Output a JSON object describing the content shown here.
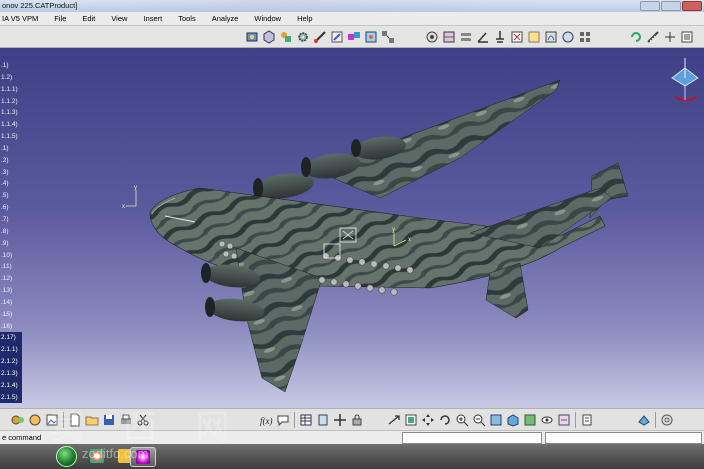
{
  "window": {
    "title": "onov 225.CATProduct]"
  },
  "menubar": {
    "app_label": "IA V5 VPM",
    "items": [
      {
        "label": "File"
      },
      {
        "label": "Edit"
      },
      {
        "label": "View"
      },
      {
        "label": "Insert"
      },
      {
        "label": "Tools"
      },
      {
        "label": "Analyze"
      },
      {
        "label": "Window"
      },
      {
        "label": "Help"
      }
    ]
  },
  "tree": {
    "items": [
      ".1)",
      "1.2)",
      "1.1.1)",
      "1.1.2)",
      "1.1.3)",
      "1.1.4)",
      "1.1.5)",
      ".1)",
      ".2)",
      ".3)",
      ".4)",
      ".5)",
      ".6)",
      ".7)",
      ".8)",
      ".9)",
      ".10)",
      ".11)",
      ".12)",
      ".13)",
      ".14)",
      ".15)",
      ".16)",
      "2.17)",
      "2.1.1)",
      "2.1.2)",
      "2.1.3)",
      "2.1.4)",
      "2.1.5)"
    ]
  },
  "status": {
    "message": "e command"
  },
  "watermark": {
    "text": "莫 西 网",
    "url": "zoditfo.com"
  },
  "colors": {
    "viewport_top": "#3f3f86",
    "viewport_bottom": "#c9c9e4",
    "camo_dark": "#2f3a3c",
    "camo_mid": "#5c6a66",
    "camo_light": "#8a968c"
  }
}
